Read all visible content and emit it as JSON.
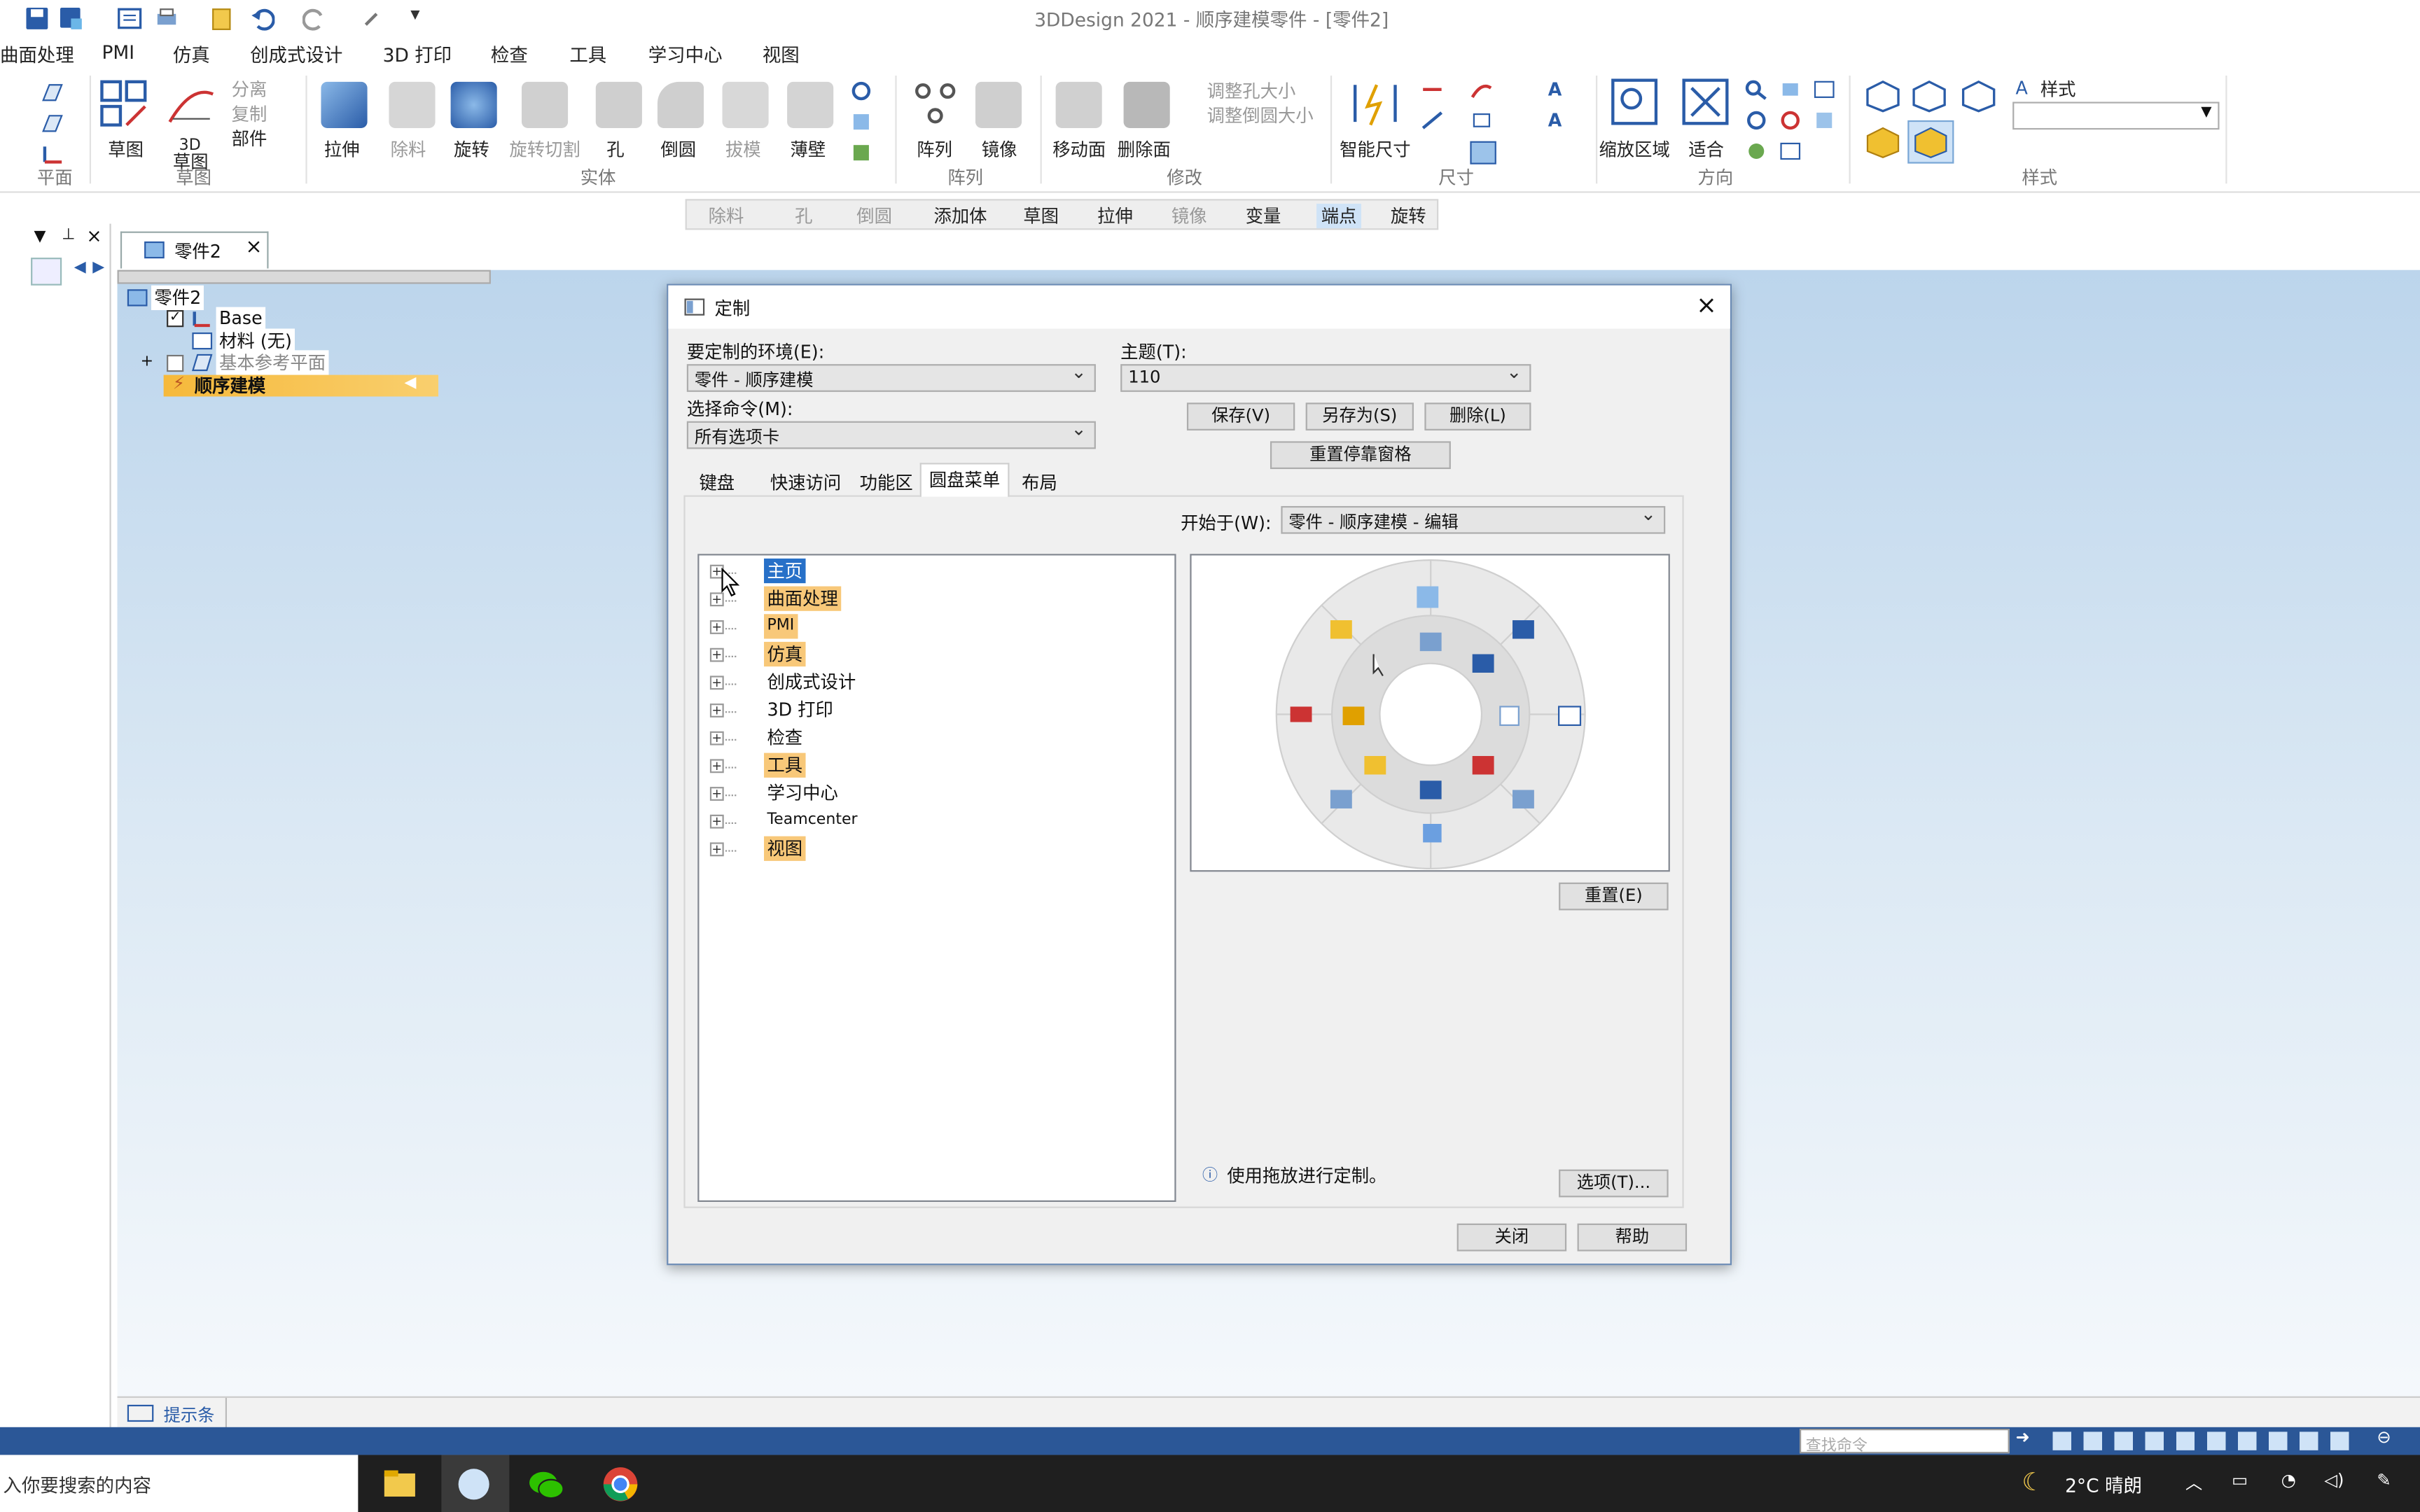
{
  "app_title": "3DDesign 2021 - 顺序建模零件 - [零件2]",
  "menu_items": [
    "曲面处理",
    "PMI",
    "仿真",
    "创成式设计",
    "3D 打印",
    "检查",
    "工具",
    "学习中心",
    "视图"
  ],
  "ribbon": {
    "plane_label": "平面",
    "sketch": {
      "sketch": "草图",
      "sketch3d": "3D",
      "sketch3d_sub": "草图",
      "split": "分离",
      "copy": "复制",
      "part": "部件",
      "group": "草图"
    },
    "solid": {
      "extrude": "拉伸",
      "cut": "除料",
      "revolve": "旋转",
      "revolve_cut": "旋转切割",
      "hole": "孔",
      "round": "倒圆",
      "draft": "拔模",
      "thin": "薄壁",
      "group": "实体"
    },
    "pattern": {
      "pattern": "阵列",
      "mirror": "镜像",
      "group": "阵列"
    },
    "modify": {
      "move_face": "移动面",
      "delete_face": "删除面",
      "resize_hole": "调整孔大小",
      "resize_round": "调整倒圆大小",
      "group": "修改"
    },
    "dimension": {
      "smart": "智能尺寸",
      "group": "尺寸"
    },
    "orient": {
      "zoom_area": "缩放区域",
      "fit": "适合",
      "group": "方向"
    },
    "style": {
      "label": "样式",
      "group": "样式"
    }
  },
  "command_bar": [
    "除料",
    "孔",
    "倒圆",
    "添加体",
    "草图",
    "拉伸",
    "镜像",
    "变量",
    "端点",
    "旋转"
  ],
  "doc_tab": "零件2",
  "tree": {
    "root": "零件2",
    "base": "Base",
    "material": "材料 (无)",
    "ref_planes": "基本参考平面",
    "seq": "顺序建模"
  },
  "hint_bar": "提示条",
  "status_search_placeholder": "查找命令",
  "taskbar": {
    "search": "入你要搜索的内容",
    "weather": "2°C 晴朗"
  },
  "dialog": {
    "title": "定制",
    "env_label": "要定制的环境(E):",
    "env_value": "零件 - 顺序建模",
    "theme_label": "主题(T):",
    "theme_value": "110",
    "select_label": "选择命令(M):",
    "select_value": "所有选项卡",
    "save": "保存(V)",
    "save_as": "另存为(S)",
    "delete": "删除(L)",
    "reset_dock": "重置停靠窗格",
    "tabs": [
      "键盘",
      "快速访问",
      "功能区",
      "圆盘菜单",
      "布局"
    ],
    "active_tab": "圆盘菜单",
    "start_label": "开始于(W):",
    "start_value": "零件 - 顺序建模 - 编辑",
    "list": [
      {
        "label": "主页",
        "state": "selected"
      },
      {
        "label": "曲面处理",
        "state": "highlight"
      },
      {
        "label": "PMI",
        "state": "highlight"
      },
      {
        "label": "仿真",
        "state": "highlight"
      },
      {
        "label": "创成式设计",
        "state": "normal"
      },
      {
        "label": "3D 打印",
        "state": "normal"
      },
      {
        "label": "检查",
        "state": "normal"
      },
      {
        "label": "工具",
        "state": "highlight"
      },
      {
        "label": "学习中心",
        "state": "normal"
      },
      {
        "label": "Teamcenter",
        "state": "normal"
      },
      {
        "label": "视图",
        "state": "highlight"
      }
    ],
    "reset": "重置(E)",
    "info": "使用拖放进行定制。",
    "options": "选项(T)...",
    "close": "关闭",
    "help": "帮助"
  },
  "colors": {
    "highlight": "#f8c879",
    "selected": "#2770c8",
    "canvas_top": "#bcd5ec",
    "status_blue": "#2b5797"
  }
}
